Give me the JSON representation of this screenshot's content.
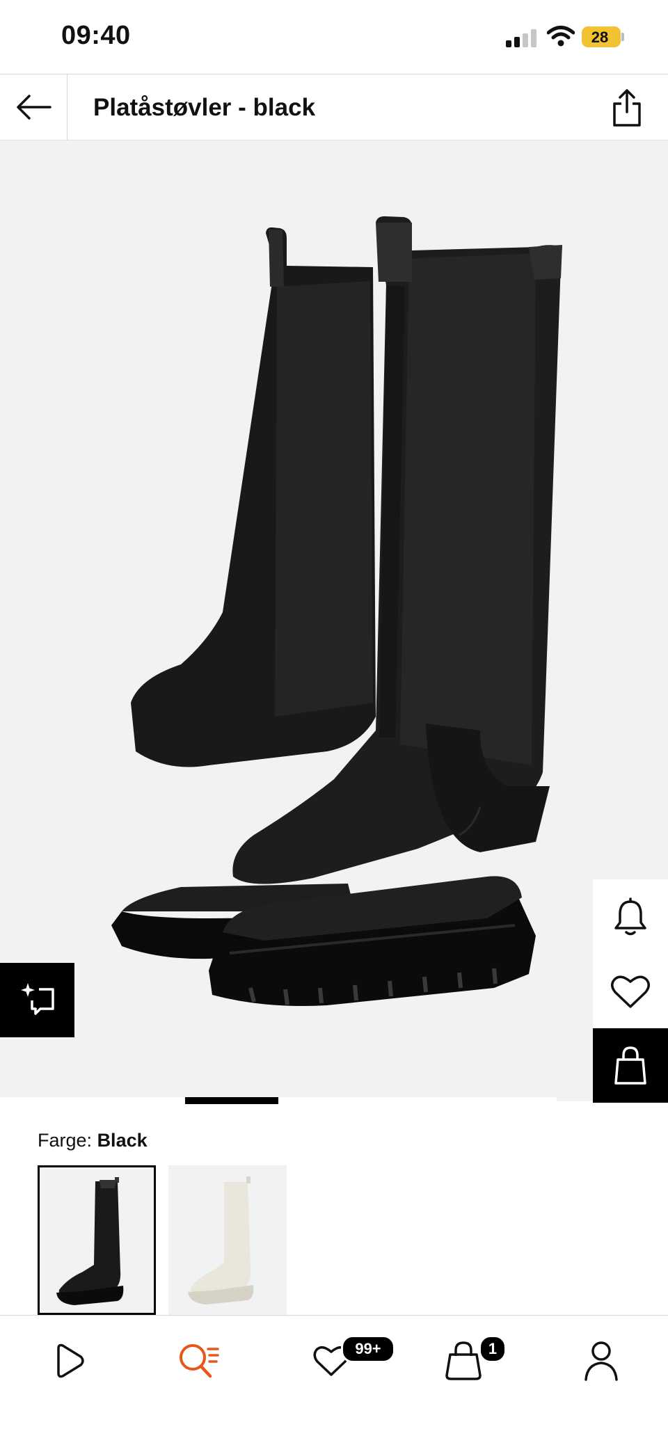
{
  "status_bar": {
    "time": "09:40",
    "battery": "28"
  },
  "header": {
    "title": "Platåstøvler - black"
  },
  "product": {
    "image_count": 4,
    "active_image": 2
  },
  "color_selector": {
    "label": "Farge:",
    "selected_value": "Black",
    "options": [
      "black",
      "white"
    ]
  },
  "tab_bar": {
    "wishlist_badge": "99+",
    "bag_badge": "1"
  },
  "colors": {
    "accent": "#e8561b",
    "black": "#000000",
    "image_bg": "#f1f2f4",
    "battery": "#f1c232"
  }
}
